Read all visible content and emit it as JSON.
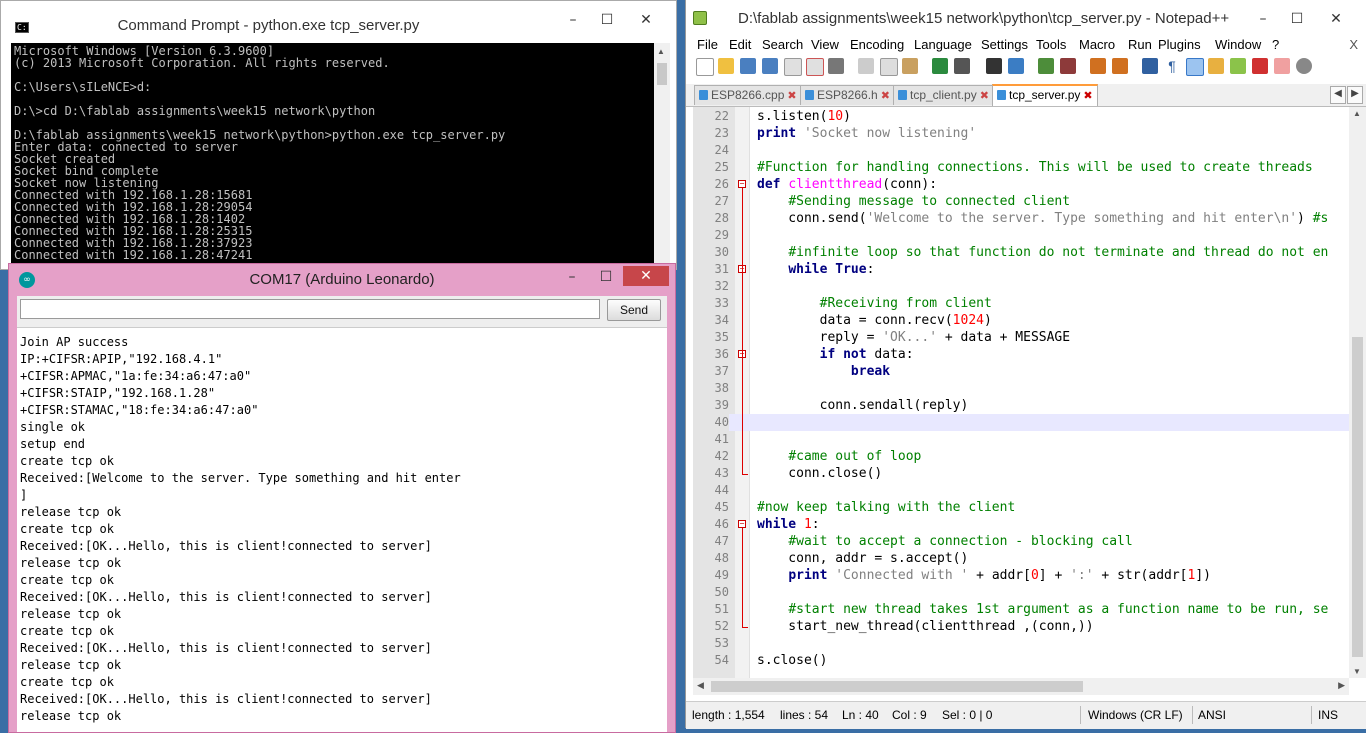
{
  "cmd": {
    "title": "Command Prompt - python.exe  tcp_server.py",
    "output": "Microsoft Windows [Version 6.3.9600]\n(c) 2013 Microsoft Corporation. All rights reserved.\n\nC:\\Users\\sILeNCE>d:\n\nD:\\>cd D:\\fablab assignments\\week15 network\\python\n\nD:\\fablab assignments\\week15 network\\python>python.exe tcp_server.py\nEnter data: connected to server\nSocket created\nSocket bind complete\nSocket now listening\nConnected with 192.168.1.28:15681\nConnected with 192.168.1.28:29054\nConnected with 192.168.1.28:1402\nConnected with 192.168.1.28:25315\nConnected with 192.168.1.28:37923\nConnected with 192.168.1.28:47241"
  },
  "arduino": {
    "title": "COM17 (Arduino Leonardo)",
    "send_label": "Send",
    "input_value": "",
    "serial_output": "Join AP success\nIP:+CIFSR:APIP,\"192.168.4.1\"\n+CIFSR:APMAC,\"1a:fe:34:a6:47:a0\"\n+CIFSR:STAIP,\"192.168.1.28\"\n+CIFSR:STAMAC,\"18:fe:34:a6:47:a0\"\nsingle ok\nsetup end\ncreate tcp ok\nReceived:[Welcome to the server. Type something and hit enter\n]\nrelease tcp ok\ncreate tcp ok\nReceived:[OK...Hello, this is client!connected to server]\nrelease tcp ok\ncreate tcp ok\nReceived:[OK...Hello, this is client!connected to server]\nrelease tcp ok\ncreate tcp ok\nReceived:[OK...Hello, this is client!connected to server]\nrelease tcp ok\ncreate tcp ok\nReceived:[OK...Hello, this is client!connected to server]\nrelease tcp ok"
  },
  "npp": {
    "title": "D:\\fablab assignments\\week15 network\\python\\tcp_server.py - Notepad++",
    "menu": [
      "File",
      "Edit",
      "Search",
      "View",
      "Encoding",
      "Language",
      "Settings",
      "Tools",
      "Macro",
      "Run",
      "Plugins",
      "Window",
      "?"
    ],
    "menu_close": "X",
    "tabs": [
      "ESP8266.cpp",
      "ESP8266.h",
      "tcp_client.py",
      "tcp_server.py"
    ],
    "active_tab": 3,
    "lines": [
      {
        "n": "22",
        "code": "s.listen(10)"
      },
      {
        "n": "23",
        "code": "print 'Socket now listening'"
      },
      {
        "n": "24",
        "code": ""
      },
      {
        "n": "25",
        "code": "#Function for handling connections. This will be used to create threads"
      },
      {
        "n": "26",
        "code": "def clientthread(conn):"
      },
      {
        "n": "27",
        "code": "    #Sending message to connected client"
      },
      {
        "n": "28",
        "code": "    conn.send('Welcome to the server. Type something and hit enter\\n') #s"
      },
      {
        "n": "29",
        "code": ""
      },
      {
        "n": "30",
        "code": "    #infinite loop so that function do not terminate and thread do not en"
      },
      {
        "n": "31",
        "code": "    while True:"
      },
      {
        "n": "32",
        "code": ""
      },
      {
        "n": "33",
        "code": "        #Receiving from client"
      },
      {
        "n": "34",
        "code": "        data = conn.recv(1024)"
      },
      {
        "n": "35",
        "code": "        reply = 'OK...' + data + MESSAGE"
      },
      {
        "n": "36",
        "code": "        if not data:"
      },
      {
        "n": "37",
        "code": "            break"
      },
      {
        "n": "38",
        "code": ""
      },
      {
        "n": "39",
        "code": "        conn.sendall(reply)"
      },
      {
        "n": "40",
        "code": ""
      },
      {
        "n": "41",
        "code": ""
      },
      {
        "n": "42",
        "code": "    #came out of loop"
      },
      {
        "n": "43",
        "code": "    conn.close()"
      },
      {
        "n": "44",
        "code": ""
      },
      {
        "n": "45",
        "code": "#now keep talking with the client"
      },
      {
        "n": "46",
        "code": "while 1:"
      },
      {
        "n": "47",
        "code": "    #wait to accept a connection - blocking call"
      },
      {
        "n": "48",
        "code": "    conn, addr = s.accept()"
      },
      {
        "n": "49",
        "code": "    print 'Connected with ' + addr[0] + ':' + str(addr[1])"
      },
      {
        "n": "50",
        "code": ""
      },
      {
        "n": "51",
        "code": "    #start new thread takes 1st argument as a function name to be run, se"
      },
      {
        "n": "52",
        "code": "    start_new_thread(clientthread ,(conn,))"
      },
      {
        "n": "53",
        "code": ""
      },
      {
        "n": "54",
        "code": "s.close()"
      }
    ],
    "current_line": "40",
    "status": {
      "length": "length : 1,554",
      "lines": "lines : 54",
      "ln": "Ln : 40",
      "col": "Col : 9",
      "sel": "Sel : 0 | 0",
      "eol": "Windows (CR LF)",
      "encoding": "ANSI",
      "mode": "INS"
    }
  }
}
